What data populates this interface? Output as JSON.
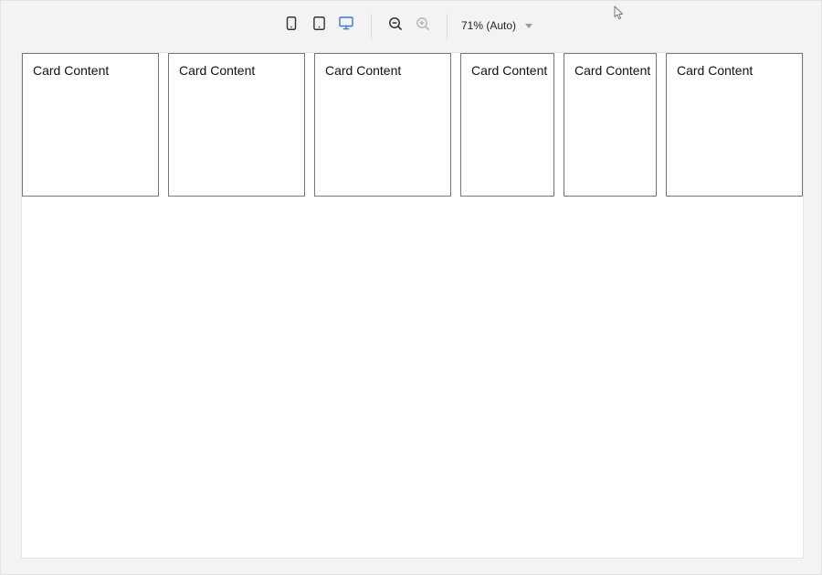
{
  "toolbar": {
    "devices": [
      {
        "name": "mobile",
        "icon": "mobile-icon",
        "active": false
      },
      {
        "name": "tablet",
        "icon": "tablet-icon",
        "active": false
      },
      {
        "name": "desktop",
        "icon": "desktop-icon",
        "active": true
      }
    ],
    "zoom_out_icon": "zoom-out-icon",
    "zoom_in_icon": "zoom-in-icon",
    "zoom_label": "71% (Auto)"
  },
  "colors": {
    "active_icon": "#3b7ad9",
    "icon": "#333333",
    "disabled_icon": "#b5b5b5"
  },
  "cards": [
    {
      "text": "Card Content"
    },
    {
      "text": "Card Content"
    },
    {
      "text": "Card Content"
    },
    {
      "text": "Card Content"
    },
    {
      "text": "Card Content"
    },
    {
      "text": "Card Content"
    }
  ]
}
